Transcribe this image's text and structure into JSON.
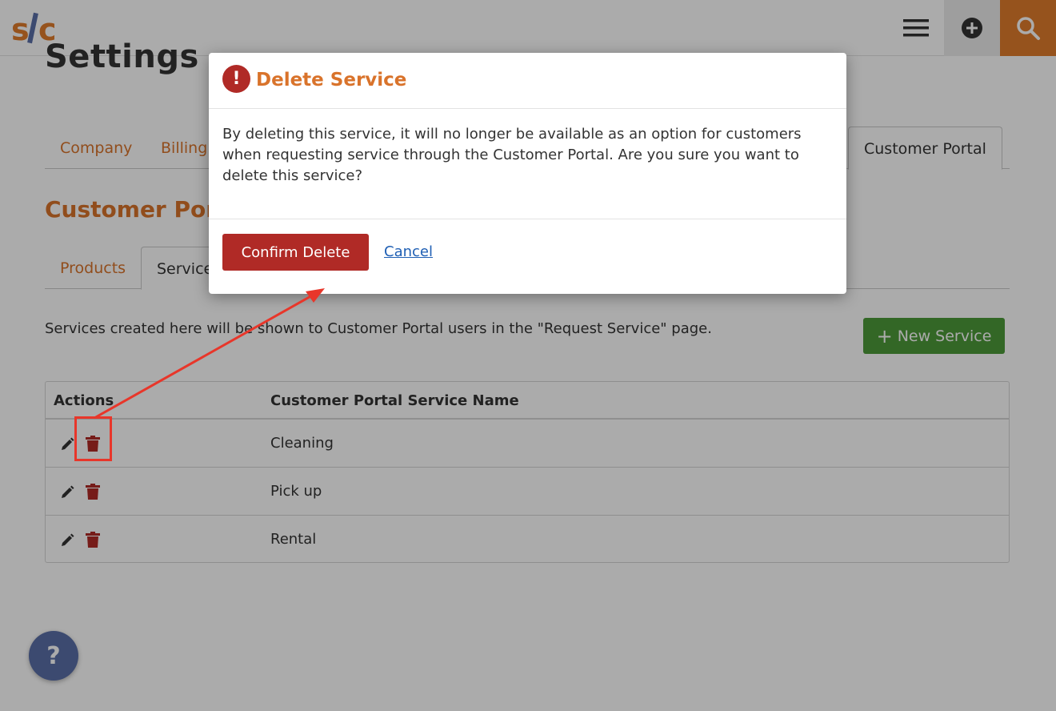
{
  "header": {
    "logo_text": "s/c",
    "colors": {
      "accent": "#e07c2c"
    }
  },
  "page": {
    "title": "Settings",
    "tabs": [
      {
        "label": "Company"
      },
      {
        "label": "Billing"
      },
      {
        "label": "Customer Portal",
        "active": true
      }
    ],
    "section_title": "Customer Portal",
    "subtabs": [
      {
        "label": "Products"
      },
      {
        "label": "Services",
        "active": true
      }
    ],
    "description": "Services created here will be shown to Customer Portal users in the \"Request Service\" page.",
    "new_service_label": "New Service",
    "table": {
      "headers": [
        "Actions",
        "Customer Portal Service Name"
      ],
      "rows": [
        {
          "name": "Cleaning"
        },
        {
          "name": "Pick up"
        },
        {
          "name": "Rental"
        }
      ]
    },
    "help_label": "?"
  },
  "modal": {
    "title": "Delete Service",
    "body": "By deleting this service, it will no longer be available as an option for customers when requesting service through the Customer Portal. Are you sure you want to delete this service?",
    "confirm_label": "Confirm Delete",
    "cancel_label": "Cancel"
  }
}
